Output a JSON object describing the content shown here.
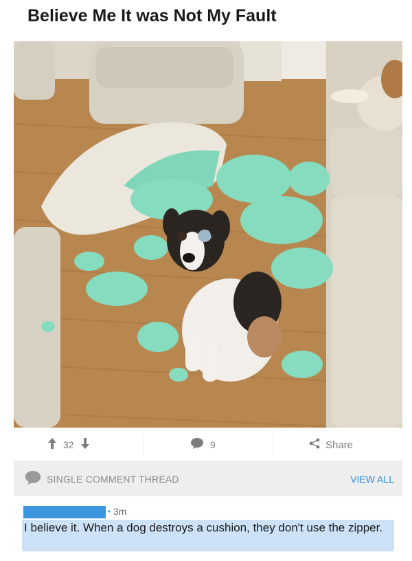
{
  "post": {
    "title": "Believe Me It was Not My Fault"
  },
  "actions": {
    "upvotes": "32",
    "comments": "9",
    "share_label": "Share"
  },
  "thread": {
    "label": "SINGLE COMMENT THREAD",
    "view_all": "VIEW ALL"
  },
  "comment": {
    "time": "3m",
    "body": "I believe it. When a dog destroys a cushion, they don't use the zipper."
  },
  "icons": {
    "upvote": "arrow-up-icon",
    "downvote": "arrow-down-icon",
    "comment": "speech-bubble-icon",
    "share": "share-icon"
  },
  "colors": {
    "link": "#2d8ad6",
    "highlight": "#cde2f6",
    "redaction": "#3d95e0"
  }
}
